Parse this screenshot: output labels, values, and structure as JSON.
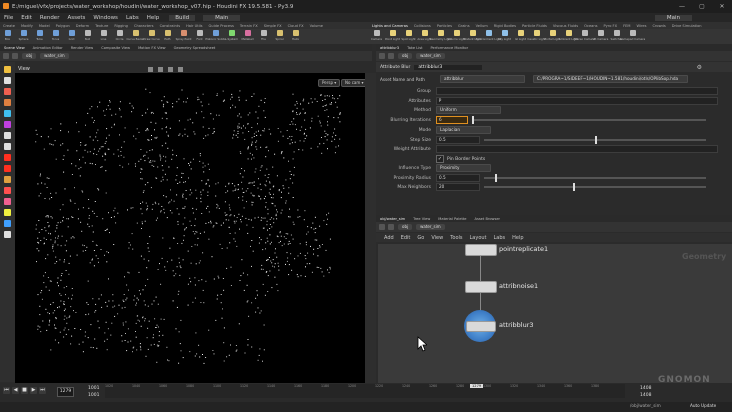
{
  "window": {
    "title": "E:/miguel/vfx/projects/water_workshop/houdini/water_workshop_v07.hip - Houdini FX 19.5.581 - Py3.9",
    "controls": [
      "—",
      "▢",
      "✕"
    ]
  },
  "menu": {
    "items": [
      "File",
      "Edit",
      "Render",
      "Assets",
      "Windows",
      "Labs",
      "Help"
    ],
    "build": "Build",
    "desktop": "Main",
    "right_desktop": "Main"
  },
  "shelf_left": {
    "tabs": [
      "Create",
      "Modify",
      "Model",
      "Polygon",
      "Deform",
      "Texture",
      "Rigging",
      "Characters",
      "Constraints",
      "Hair Utils",
      "Guide Process",
      "Terrain FX",
      "Simple FX",
      "Cloud FX",
      "Volume"
    ],
    "tools": [
      {
        "label": "Box",
        "color": "#6f9fd8"
      },
      {
        "label": "Sphere",
        "color": "#6f9fd8"
      },
      {
        "label": "Tube",
        "color": "#6f9fd8"
      },
      {
        "label": "Torus",
        "color": "#6f9fd8"
      },
      {
        "label": "Grid",
        "color": "#6f9fd8"
      },
      {
        "label": "Null",
        "color": "#bbbbbb"
      },
      {
        "label": "Line",
        "color": "#bbbbbb"
      },
      {
        "label": "Circle",
        "color": "#bbbbbb"
      },
      {
        "label": "Curve Bezier",
        "color": "#d8c06f"
      },
      {
        "label": "Draw Curve",
        "color": "#d8c06f"
      },
      {
        "label": "Path",
        "color": "#d8c06f"
      },
      {
        "label": "Spray Paint",
        "color": "#d88f6f"
      },
      {
        "label": "Font",
        "color": "#bbbbbb"
      },
      {
        "label": "Platonic Solids",
        "color": "#6f9fd8"
      },
      {
        "label": "L-System",
        "color": "#7fd86f"
      },
      {
        "label": "Metaball",
        "color": "#d86f9f"
      },
      {
        "label": "File",
        "color": "#bbbbbb"
      },
      {
        "label": "Spiral",
        "color": "#d8c06f"
      },
      {
        "label": "Helix",
        "color": "#d8c06f"
      }
    ]
  },
  "shelf_right": {
    "tabs": [
      "Lights and Cameras",
      "Collisions",
      "Particles",
      "Grains",
      "Vellum",
      "Rigid Bodies",
      "Particle Fluids",
      "Viscous Fluids",
      "Oceans",
      "Pyro FX",
      "FEM",
      "Wires",
      "Crowds",
      "Drive Simulation"
    ],
    "tools": [
      {
        "label": "Camera",
        "color": "#bbbbbb"
      },
      {
        "label": "Point Light",
        "color": "#e8d27a"
      },
      {
        "label": "Spot Light",
        "color": "#e8d27a"
      },
      {
        "label": "Area Light",
        "color": "#e8d27a"
      },
      {
        "label": "Geometry Light",
        "color": "#e8d27a"
      },
      {
        "label": "Volume Light",
        "color": "#e8d27a"
      },
      {
        "label": "Distant Light",
        "color": "#e8d27a"
      },
      {
        "label": "Environment Light",
        "color": "#8fc0e8"
      },
      {
        "label": "Sky Light",
        "color": "#8fc0e8"
      },
      {
        "label": "GI Light",
        "color": "#e8d27a"
      },
      {
        "label": "Caustic Light",
        "color": "#e8d27a"
      },
      {
        "label": "Portal Light",
        "color": "#e8d27a"
      },
      {
        "label": "Ambient Light",
        "color": "#e8d27a"
      },
      {
        "label": "Stereo Camera",
        "color": "#bbbbbb"
      },
      {
        "label": "VR Camera",
        "color": "#bbbbbb"
      },
      {
        "label": "Switcher",
        "color": "#bbbbbb"
      },
      {
        "label": "Gamepad Camera",
        "color": "#bbbbbb"
      }
    ]
  },
  "left_pane": {
    "tabs": [
      "Scene View",
      "Animation Editor",
      "Render View",
      "Composite View",
      "Motion FX View",
      "Geometry Spreadsheet"
    ],
    "path": "obj",
    "node": "water_sim",
    "view_label": "View",
    "persp": "Persp ▾",
    "cam": "No cam ▾"
  },
  "right_top": {
    "tabs": [
      "attribblur3",
      "Take List",
      "Performance Monitor"
    ],
    "path": "obj",
    "node": "water_sim",
    "node_type": "Attribute Blur",
    "node_name": "attribblur3",
    "asset_label": "Asset Name and Path",
    "asset_name": "attribblur",
    "asset_path": "C:/PROGRA~1/SIDEEF~1/HOUDIN~1.581/houdini/otls/OPlibSop.hda",
    "params": [
      {
        "label": "Group",
        "value": ""
      },
      {
        "label": "Attributes",
        "value": "P"
      },
      {
        "label": "Method",
        "value": "Uniform"
      },
      {
        "label": "Blurring Iterations",
        "value": "6"
      },
      {
        "label": "Mode",
        "value": "Laplacian"
      },
      {
        "label": "Step Size",
        "value": "0.5"
      },
      {
        "label": "Weight Attribute",
        "value": ""
      },
      {
        "label": "Pin Border Points",
        "value": "✓"
      },
      {
        "label": "Influence Type",
        "value": "Proximity"
      },
      {
        "label": "Proximity Radius",
        "value": "0.5"
      },
      {
        "label": "Max Neighbors",
        "value": "20"
      }
    ],
    "step_size_fill": 0.5,
    "prox_fill": 0.05,
    "maxn_fill": 0.4
  },
  "right_bottom": {
    "tabs": [
      "obj/water_sim",
      "Tree View",
      "Material Palette",
      "Asset Browser"
    ],
    "path": "obj",
    "node": "water_sim",
    "menu": [
      "Add",
      "Edit",
      "Go",
      "View",
      "Tools",
      "Layout",
      "Labs",
      "Help"
    ],
    "context": "Geometry",
    "nodes": [
      "pointreplicate1",
      "attribnoise1",
      "attribblur3"
    ]
  },
  "timeline": {
    "frame": "1279",
    "start": "1001",
    "end": "1001",
    "ticks": [
      "1020",
      "1040",
      "1060",
      "1080",
      "1100",
      "1120",
      "1140",
      "1160",
      "1180",
      "1200",
      "1220",
      "1240",
      "1260",
      "1280",
      "1300",
      "1320",
      "1340",
      "1360",
      "1380"
    ],
    "current_marker": "1279",
    "range_end_a": "1408",
    "range_end_b": "1408",
    "status_path": "/obj/water_sim",
    "auto_update": "Auto Update",
    "watermark": "GNOMON"
  }
}
